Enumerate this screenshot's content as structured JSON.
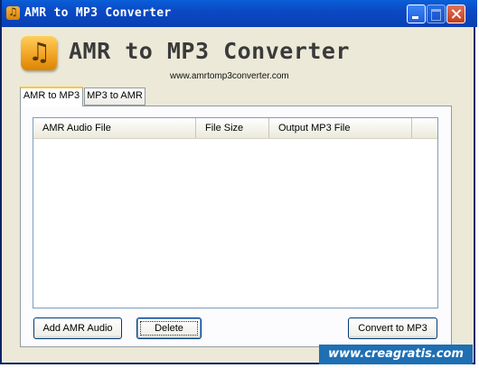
{
  "window": {
    "title": "AMR to MP3 Converter"
  },
  "header": {
    "app_title": "AMR to MP3 Converter",
    "website": "www.amrtomp3converter.com",
    "logo_icon": "music-folder-icon"
  },
  "tabs": [
    {
      "label": "AMR to MP3",
      "active": true
    },
    {
      "label": "MP3 to AMR",
      "active": false
    }
  ],
  "file_list": {
    "columns": [
      "AMR Audio File",
      "File Size",
      "Output MP3 File"
    ],
    "rows": []
  },
  "buttons": {
    "add": "Add AMR Audio",
    "delete": "Delete",
    "convert": "Convert to MP3"
  },
  "watermark": "www.creagratis.com",
  "colors": {
    "titlebar": "#0b49c4",
    "window_bg": "#ece9d8",
    "active_tab_accent": "#ffc83c",
    "watermark_bg": "#1e6fb3"
  }
}
